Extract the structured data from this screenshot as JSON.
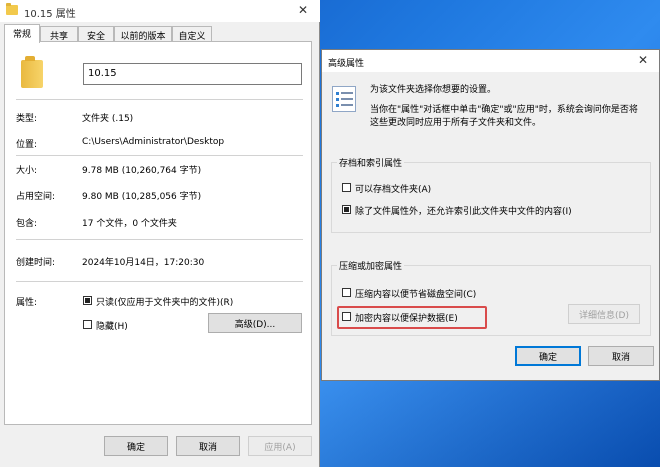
{
  "props_window": {
    "title": "10.15 属性",
    "close_glyph": "✕",
    "tabs": [
      {
        "label": "常规",
        "active": true
      },
      {
        "label": "共享"
      },
      {
        "label": "安全"
      },
      {
        "label": "以前的版本"
      },
      {
        "label": "自定义"
      }
    ],
    "name_value": "10.15",
    "rows": {
      "type_label": "类型:",
      "type_value": "文件夹 (.15)",
      "location_label": "位置:",
      "location_value": "C:\\Users\\Administrator\\Desktop",
      "size_label": "大小:",
      "size_value": "9.78 MB (10,260,764 字节)",
      "disk_label": "占用空间:",
      "disk_value": "9.80 MB (10,285,056 字节)",
      "contains_label": "包含:",
      "contains_value": "17 个文件，0 个文件夹",
      "created_label": "创建时间:",
      "created_value": "2024年10月14日，17:20:30",
      "attr_label": "属性:"
    },
    "attributes": {
      "readonly_label": "只读(仅应用于文件夹中的文件)(R)",
      "readonly_checked": true,
      "hidden_label": "隐藏(H)",
      "hidden_checked": false,
      "advanced_button": "高级(D)..."
    },
    "buttons": {
      "ok": "确定",
      "cancel": "取消",
      "apply": "应用(A)"
    }
  },
  "advanced_dialog": {
    "title": "高级属性",
    "close_glyph": "✕",
    "intro": "为该文件夹选择你想要的设置。",
    "desc_line1": "当你在\"属性\"对话框中单击\"确定\"或\"应用\"时，系统会询问你是否将",
    "desc_line2": "这些更改同时应用于所有子文件夹和文件。",
    "archive_group": {
      "title": "存档和索引属性",
      "archive_label": "可以存档文件夹(A)",
      "archive_checked": false,
      "index_label": "除了文件属性外，还允许索引此文件夹中文件的内容(I)",
      "index_checked": true
    },
    "compress_group": {
      "title": "压缩或加密属性",
      "compress_label": "压缩内容以便节省磁盘空间(C)",
      "compress_checked": false,
      "encrypt_label": "加密内容以便保护数据(E)",
      "encrypt_checked": false,
      "details_button": "详细信息(D)"
    },
    "buttons": {
      "ok": "确定",
      "cancel": "取消"
    }
  },
  "colors": {
    "highlight": "#d94b4b",
    "accent": "#0078d7",
    "desktop": "#1f78df"
  }
}
